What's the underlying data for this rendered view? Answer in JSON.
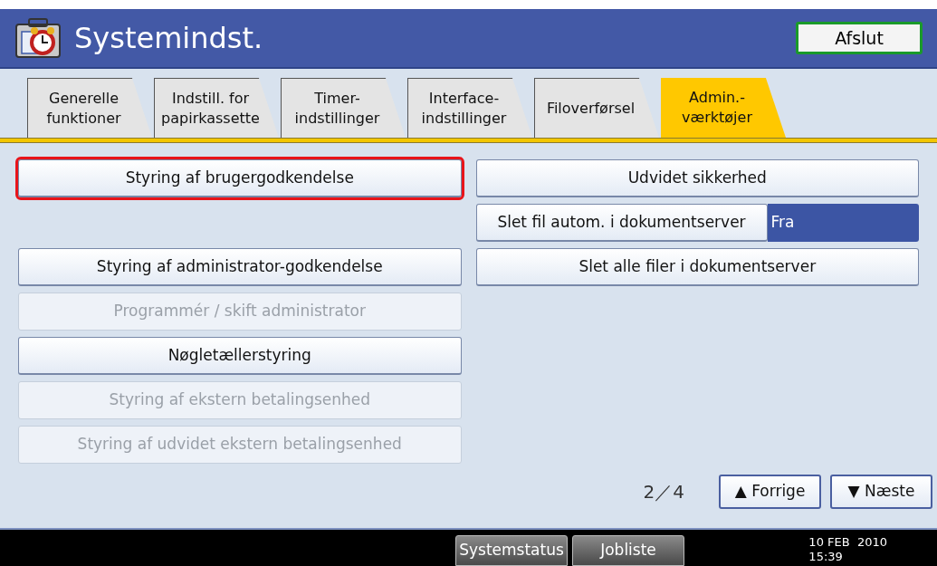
{
  "window": {
    "title": "Systemindst.",
    "exit_button": "Afslut"
  },
  "tabs": [
    {
      "label": "Generelle\nfunktioner",
      "selected": false
    },
    {
      "label": "Indstill. for\npapirkassette",
      "selected": false
    },
    {
      "label": "Timer-\nindstillinger",
      "selected": false
    },
    {
      "label": "Interface-\nindstillinger",
      "selected": false
    },
    {
      "label": "Filoverførsel",
      "selected": false
    },
    {
      "label": "Admin.-\nværktøjer",
      "selected": true
    }
  ],
  "left_buttons": [
    {
      "label": "Styring af brugergodkendelse",
      "selected": true,
      "disabled": false
    },
    {
      "label": "Styring af administrator-godkendelse",
      "selected": false,
      "disabled": false
    },
    {
      "label": "Programmér / skift administrator",
      "selected": false,
      "disabled": true
    },
    {
      "label": "Nøgletællerstyring",
      "selected": false,
      "disabled": false
    },
    {
      "label": "Styring af ekstern betalingsenhed",
      "selected": false,
      "disabled": true
    },
    {
      "label": "Styring af udvidet ekstern betalingsenhed",
      "selected": false,
      "disabled": true
    }
  ],
  "right_buttons": [
    {
      "kind": "button",
      "label": "Udvidet sikkerhed"
    },
    {
      "kind": "setting",
      "label": "Slet fil autom. i dokumentserver",
      "value": "Fra"
    },
    {
      "kind": "button",
      "label": "Slet alle filer i dokumentserver"
    }
  ],
  "pager": {
    "page": "2／4",
    "prev": {
      "arrow": "▲",
      "label": "Forrige"
    },
    "next": {
      "arrow": "▼",
      "label": "Næste"
    }
  },
  "status_bar": {
    "buttons": [
      "Systemstatus",
      "Jobliste"
    ],
    "date": "10 FEB  2010",
    "time": "15:39"
  }
}
